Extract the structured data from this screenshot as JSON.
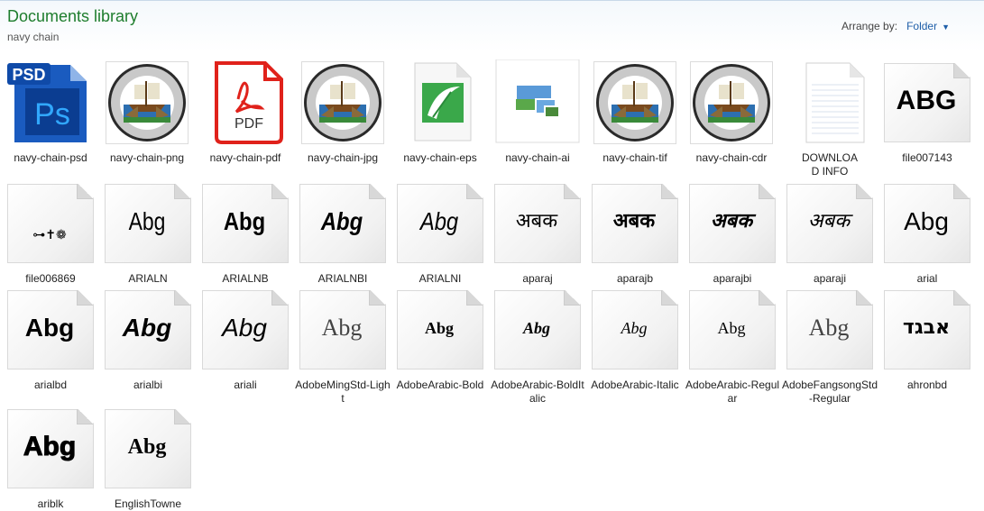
{
  "header": {
    "title": "Documents library",
    "subtitle": "navy chain",
    "arrange_label": "Arrange by:",
    "arrange_value": "Folder"
  },
  "items": [
    {
      "label": "navy-chain-psd",
      "icon": "photoshop-file-icon"
    },
    {
      "label": "navy-chain-png",
      "icon": "navy-seal-thumbnail"
    },
    {
      "label": "navy-chain-pdf",
      "icon": "pdf-file-icon",
      "icon_text": "PDF"
    },
    {
      "label": "navy-chain-jpg",
      "icon": "navy-seal-thumbnail"
    },
    {
      "label": "navy-chain-eps",
      "icon": "coreldraw-file-icon"
    },
    {
      "label": "navy-chain-ai",
      "icon": "image-file-icon"
    },
    {
      "label": "navy-chain-tif",
      "icon": "navy-seal-thumbnail"
    },
    {
      "label": "navy-chain-cdr",
      "icon": "navy-seal-thumbnail"
    },
    {
      "label": "DOWNLOAD INFO",
      "icon": "text-document-icon"
    },
    {
      "label": "file007143",
      "icon": "font-file-icon",
      "glyph": "ABG"
    },
    {
      "label": "file006869",
      "icon": "font-file-icon",
      "glyph": "⊶✝❁"
    },
    {
      "label": "ARIALN",
      "icon": "font-file-icon",
      "glyph": "Abg"
    },
    {
      "label": "ARIALNB",
      "icon": "font-file-icon",
      "glyph": "Abg"
    },
    {
      "label": "ARIALNBI",
      "icon": "font-file-icon",
      "glyph": "Abg"
    },
    {
      "label": "ARIALNI",
      "icon": "font-file-icon",
      "glyph": "Abg"
    },
    {
      "label": "aparaj",
      "icon": "font-file-icon",
      "glyph": "अबक"
    },
    {
      "label": "aparajb",
      "icon": "font-file-icon",
      "glyph": "अबक"
    },
    {
      "label": "aparajbi",
      "icon": "font-file-icon",
      "glyph": "अबक"
    },
    {
      "label": "aparaji",
      "icon": "font-file-icon",
      "glyph": "अबक"
    },
    {
      "label": "arial",
      "icon": "font-file-icon",
      "glyph": "Abg"
    },
    {
      "label": "arialbd",
      "icon": "font-file-icon",
      "glyph": "Abg"
    },
    {
      "label": "arialbi",
      "icon": "font-file-icon",
      "glyph": "Abg"
    },
    {
      "label": "ariali",
      "icon": "font-file-icon",
      "glyph": "Abg"
    },
    {
      "label": "AdobeMingStd-Light",
      "icon": "font-file-icon",
      "glyph": "Abg"
    },
    {
      "label": "AdobeArabic-Bold",
      "icon": "font-file-icon",
      "glyph": "Abg"
    },
    {
      "label": "AdobeArabic-BoldItalic",
      "icon": "font-file-icon",
      "glyph": "Abg"
    },
    {
      "label": "AdobeArabic-Italic",
      "icon": "font-file-icon",
      "glyph": "Abg"
    },
    {
      "label": "AdobeArabic-Regular",
      "icon": "font-file-icon",
      "glyph": "Abg"
    },
    {
      "label": "AdobeFangsongStd-Regular",
      "icon": "font-file-icon",
      "glyph": "Abg"
    },
    {
      "label": "ahronbd",
      "icon": "font-file-icon",
      "glyph": "אבגד"
    },
    {
      "label": "ariblk",
      "icon": "font-file-icon",
      "glyph": "Abg"
    },
    {
      "label": "EnglishTowne",
      "icon": "font-file-icon",
      "glyph": "Abg"
    }
  ],
  "colors": {
    "title_green": "#1e7d2d",
    "link_blue": "#1e5ea8"
  }
}
